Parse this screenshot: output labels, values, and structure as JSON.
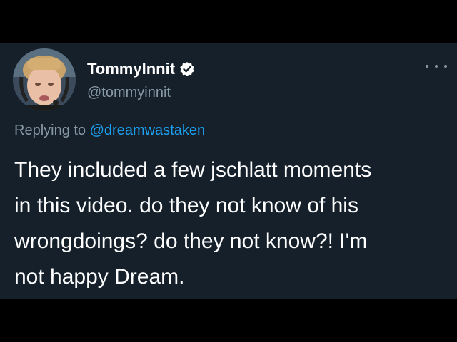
{
  "author": {
    "display_name": "TommyInnit",
    "handle": "@tommyinnit"
  },
  "reply": {
    "prefix": "Replying to ",
    "mention": "@dreamwastaken"
  },
  "tweet_lines": [
    "They included a few jschlatt moments",
    "in this video. do they not know of his",
    "wrongdoings? do they not know?! I'm",
    "not happy Dream."
  ],
  "icons": {
    "verified": "verified-badge-icon",
    "more": "more-options-icon"
  },
  "colors": {
    "background": "#15202b",
    "letterbox": "#000000",
    "secondary_text": "#8899a6",
    "link": "#1da1f2"
  }
}
